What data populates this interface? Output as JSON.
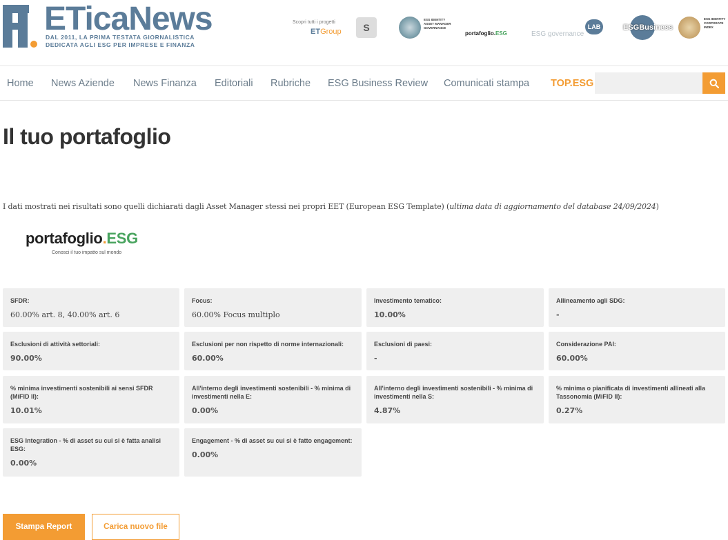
{
  "header": {
    "brand": "ETicaNews",
    "tagline_1": "DAL 2011, LA PRIMA TESTATA GIORNALISTICA",
    "tagline_2": "DEDICATA AGLI ESG PER IMPRESE E FINANZA",
    "partners_label": "Scopri tutti i progetti",
    "group_label_prefix": "ET",
    "group_label": "Group",
    "partner_s": "S",
    "partner_fp_text": "ESG IDENTITY ASSET MANAGER GOVERNANCE",
    "partner_portafoglio": "portafoglio.",
    "partner_portafoglio_esg": "ESG",
    "partner_gov": "ESG governance",
    "partner_lab": "LAB",
    "partner_esgb": "ESGBusiness",
    "partner_gold_text": "ESG IDENTITY CORPORATE INDEX"
  },
  "nav": {
    "items": [
      {
        "label": "Home"
      },
      {
        "label": "News Aziende"
      },
      {
        "label": "News Finanza"
      },
      {
        "label": "Editoriali"
      },
      {
        "label": "Rubriche"
      },
      {
        "label": "ESG Business Review"
      },
      {
        "label": "Comunicati stampa"
      },
      {
        "label": "TOP.ESG"
      }
    ],
    "search_placeholder": "",
    "search_icon": "search-icon"
  },
  "main": {
    "title": "Il tuo portafoglio",
    "disclaimer_main": "I dati mostrati nei risultati sono quelli dichiarati dagli Asset Manager stessi nei propri EET (European ESG Template) (",
    "disclaimer_italic": "ultima data di aggiornamento del database 24/09/2024",
    "disclaimer_end": ")",
    "logo_word": "portafoglio",
    "logo_dot": ".",
    "logo_esg": "ESG",
    "logo_sub": "Conosci il tuo impatto sul mondo"
  },
  "cards": [
    {
      "label": "SFDR:",
      "value": "60.00% art. 8, 40.00% art. 6"
    },
    {
      "label": "Focus:",
      "value": "60.00% Focus multiplo"
    },
    {
      "label": "Investimento tematico:",
      "value": "10.00%"
    },
    {
      "label": "Allineamento agli SDG:",
      "value": "-"
    },
    {
      "label": "Esclusioni di attività settoriali:",
      "value": "90.00%"
    },
    {
      "label": "Esclusioni per non rispetto di norme internazionali:",
      "value": "60.00%"
    },
    {
      "label": "Esclusioni di paesi:",
      "value": "-"
    },
    {
      "label": "Considerazione PAI:",
      "value": "60.00%"
    },
    {
      "label": "% minima investimenti sostenibili ai sensi SFDR (MiFID II):",
      "value": "10.01%"
    },
    {
      "label": "All'interno degli investimenti sostenibili - % minima di investimenti nella E:",
      "value": "0.00%"
    },
    {
      "label": "All'interno degli investimenti sostenibili - % minima di investimenti nella S:",
      "value": "4.87%"
    },
    {
      "label": "% minima o pianificata di investimenti allineati alla Tassonomia (MiFID II):",
      "value": "0.27%"
    },
    {
      "label": "ESG Integration - % di asset su cui si è fatta analisi ESG:",
      "value": "0.00%"
    },
    {
      "label": "Engagement - % di asset su cui si è fatto engagement:",
      "value": "0.00%"
    }
  ],
  "actions": {
    "print_label": "Stampa Report",
    "upload_label": "Carica nuovo file"
  },
  "colors": {
    "accent": "#f39c33",
    "brand": "#5b7c99",
    "esg_green": "#49a45f",
    "card_bg": "#efefef"
  }
}
